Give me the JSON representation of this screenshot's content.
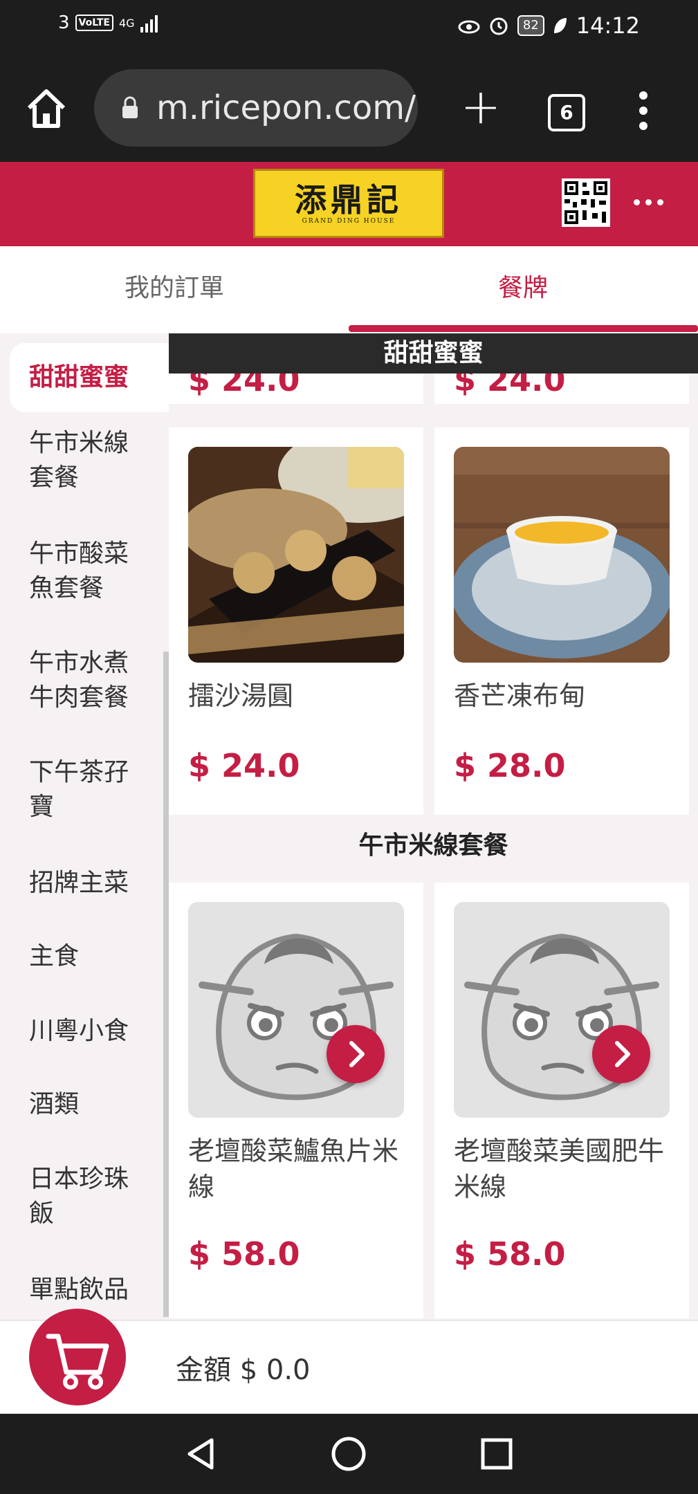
{
  "status_bar": {
    "carrier": "3",
    "volte": "VoLTE",
    "network": "4G",
    "battery": "82",
    "time": "14:12"
  },
  "browser": {
    "url": "m.ricepon.com/",
    "tab_count": "6"
  },
  "store": {
    "logo_title": "添鼎記",
    "logo_subtitle": "GRAND   DING   HOUSE"
  },
  "tabs": {
    "orders": "我的訂單",
    "menu": "餐牌"
  },
  "sidebar": {
    "items": [
      {
        "label": "甜甜蜜蜜",
        "active": true
      },
      {
        "label": "午市米線\n套餐",
        "active": false
      },
      {
        "label": "午市酸菜\n魚套餐",
        "active": false
      },
      {
        "label": "午市水煮\n牛肉套餐",
        "active": false
      },
      {
        "label": "下午茶孖\n寶",
        "active": false
      },
      {
        "label": "招牌主菜",
        "active": false
      },
      {
        "label": "主食",
        "active": false
      },
      {
        "label": "川粵小食",
        "active": false
      },
      {
        "label": "酒類",
        "active": false
      },
      {
        "label": "日本珍珠\n飯",
        "active": false
      },
      {
        "label": "單點飲品",
        "active": false
      }
    ]
  },
  "content": {
    "sticky_header": "甜甜蜜蜜",
    "partial_prices": [
      "$ 24.0",
      "$ 24.0"
    ],
    "dessert_items": [
      {
        "name": "擂沙湯圓",
        "price": "$ 24.0"
      },
      {
        "name": "香芒凍布甸",
        "price": "$ 28.0"
      }
    ],
    "section2_title": "午市米線套餐",
    "noodle_items": [
      {
        "name": "老壇酸菜鱸魚片米線",
        "price": "$ 58.0"
      },
      {
        "name": "老壇酸菜美國肥牛米線",
        "price": "$ 58.0"
      }
    ]
  },
  "cart": {
    "total_label": "金額 $ 0.0"
  },
  "colors": {
    "brand": "#c41e45",
    "dark": "#1d1d1d",
    "logo_yellow": "#f5d223"
  }
}
